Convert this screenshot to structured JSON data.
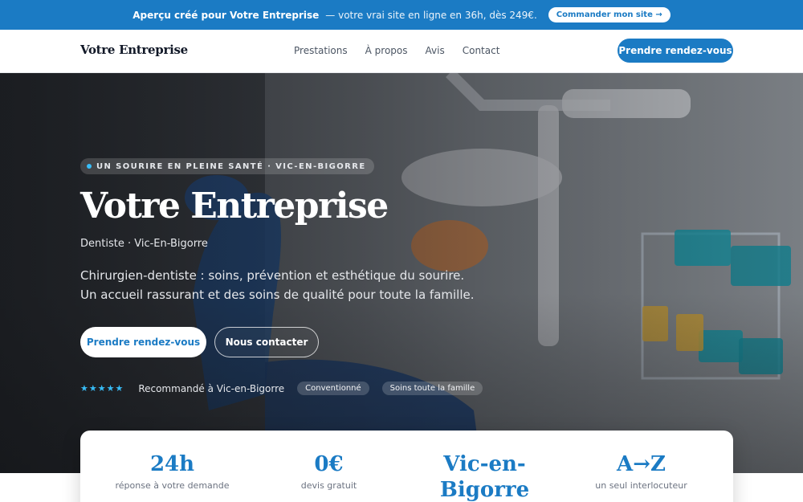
{
  "promo": {
    "bold_text": "Aperçu créé pour Votre Entreprise",
    "rest_text": "— votre vrai site en ligne en 36h, dès 249€.",
    "button_label": "Commander mon site →"
  },
  "header": {
    "logo": "Votre Entreprise",
    "nav": [
      "Prestations",
      "À propos",
      "Avis",
      "Contact"
    ],
    "cta_label": "Prendre rendez-vous"
  },
  "hero": {
    "eyebrow": "UN SOURIRE EN PLEINE SANTÉ · VIC-EN-BIGORRE",
    "title": "Votre Entreprise",
    "subtitle": "Dentiste · Vic-En-Bigorre",
    "description": "Chirurgien-dentiste : soins, prévention et esthétique du sourire. Un accueil rassurant et des soins de qualité pour toute la famille.",
    "primary_button": "Prendre rendez-vous",
    "secondary_button": "Nous contacter",
    "stars": "★★★★★",
    "trust_text": "Recommandé à Vic-en-Bigorre",
    "chips": [
      "Conventionné",
      "Soins toute la famille"
    ]
  },
  "stats": [
    {
      "value": "24h",
      "label": "réponse à votre demande"
    },
    {
      "value": "0€",
      "label": "devis gratuit"
    },
    {
      "value": "Vic-en-Bigorre",
      "label": ""
    },
    {
      "value": "A→Z",
      "label": "un seul interlocuteur"
    }
  ],
  "colors": {
    "brand": "#1b7bc4",
    "accent": "#38bdf8"
  }
}
